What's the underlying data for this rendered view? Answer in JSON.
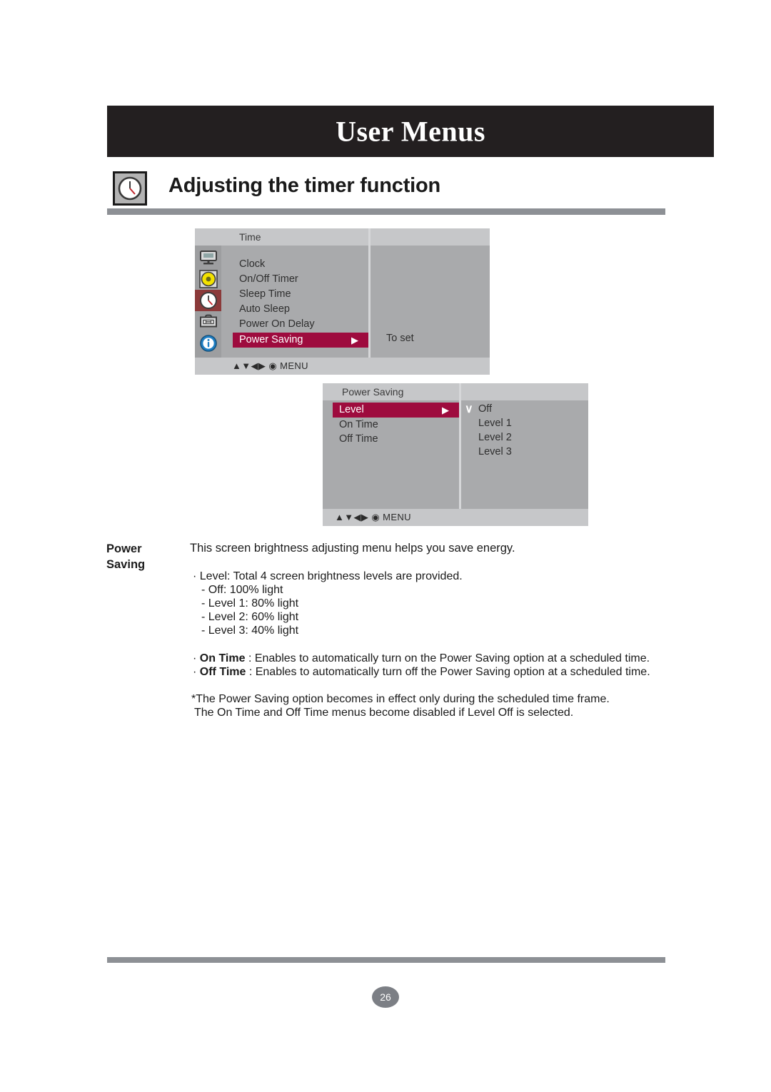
{
  "banner": {
    "title": "User Menus"
  },
  "section": {
    "icon": "clock-icon",
    "heading": "Adjusting the timer function"
  },
  "osd_time": {
    "title": "Time",
    "rail_icons": [
      "monitor-icon",
      "disc-icon",
      "clock-icon",
      "toolbox-icon",
      "info-icon"
    ],
    "active_rail_index": 2,
    "items": [
      "Clock",
      "On/Off Timer",
      "Sleep Time",
      "Auto Sleep",
      "Power On Delay"
    ],
    "selected_item": "Power  Saving",
    "selected_arrow": "▶",
    "right_text": "To set",
    "navbar": "▲▼◀▶ ◉ MENU"
  },
  "osd_power_saving": {
    "title": "Power Saving",
    "selected_item": "Level",
    "selected_arrow": "▶",
    "items": [
      "On Time",
      "Off Time"
    ],
    "options": [
      "Off",
      "Level 1",
      "Level 2",
      "Level 3"
    ],
    "checked_option": "Off",
    "check_glyph": "∨",
    "navbar": "▲▼◀▶ ◉ MENU"
  },
  "body": {
    "side_label_line1": "Power",
    "side_label_line2": "Saving",
    "lead": "This screen brightness adjusting menu helps you save energy.",
    "level_bullet": "· Level: Total 4 screen brightness levels are provided.",
    "level_lines": [
      "- Off:  100% light",
      "- Level 1: 80% light",
      "- Level 2: 60% light",
      "- Level 3: 40% light"
    ],
    "on_time_bullet_mark": "· ",
    "on_time_term": "On Time",
    "on_time_desc": " : Enables to automatically turn on the Power Saving option at a scheduled time.",
    "off_time_term": "Off Time",
    "off_time_desc": " : Enables to automatically turn off the Power Saving option at a scheduled time.",
    "note_line1": "*The Power Saving option becomes in effect only during the scheduled time frame.",
    "note_line2": "The On Time and Off Time menus become disabled if Level Off is selected."
  },
  "footer": {
    "page_number": "26"
  },
  "colors": {
    "banner_bg": "#231f20",
    "accent_magenta": "#9e0b3e",
    "rail_active": "#8b3a3a",
    "rule_gray": "#8d9095",
    "osd_body": "#a9aaac",
    "osd_title": "#c6c7c9"
  }
}
